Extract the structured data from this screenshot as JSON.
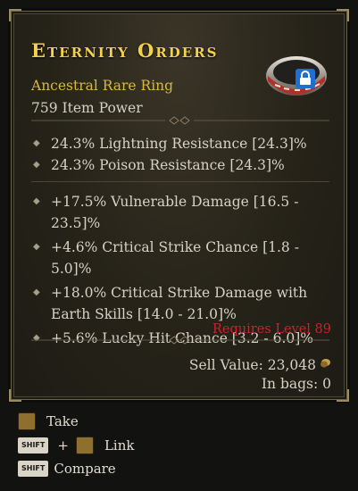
{
  "item": {
    "name": "Eternity Orders",
    "type": "Ancestral Rare Ring",
    "item_power": "759 Item Power"
  },
  "implicit_affixes": [
    "24.3% Lightning Resistance [24.3]%",
    "24.3% Poison Resistance [24.3]%"
  ],
  "affixes": [
    "+17.5% Vulnerable Damage [16.5 - 23.5]%",
    "+4.6% Critical Strike Chance [1.8 - 5.0]%",
    "+18.0% Critical Strike Damage with Earth Skills [14.0 - 21.0]%",
    "+5.6% Lucky Hit Chance [3.2 - 6.0]%"
  ],
  "requirement": "Requires Level 89",
  "sell_value": "Sell Value: 23,048",
  "in_bags": "In bags: 0",
  "actions": {
    "take": "Take",
    "shift_label": "SHIFT",
    "plus": "+",
    "link": "Link",
    "compare": "Compare"
  },
  "colors": {
    "title": "#f1d24a",
    "rarity": "#d8b93d",
    "requirement": "#c4262a",
    "text": "#d6d2c4"
  }
}
